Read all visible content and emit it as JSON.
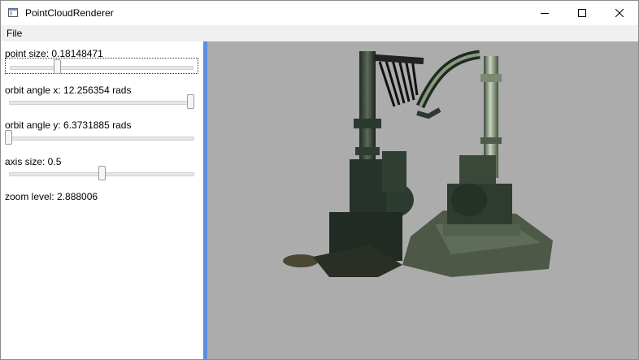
{
  "window": {
    "title": "PointCloudRenderer"
  },
  "menu": {
    "file": "File"
  },
  "controls": {
    "point_size": {
      "label": "point size: 0.18148471",
      "value_fraction": 0.26
    },
    "orbit_x": {
      "label": "orbit angle x: 12.256354 rads",
      "value_fraction": 0.98
    },
    "orbit_y": {
      "label": "orbit angle y: 6.3731885 rads",
      "value_fraction": 0.0
    },
    "axis_size": {
      "label": "axis size: 0.5",
      "value_fraction": 0.5
    },
    "zoom": {
      "label": "zoom level: 2.888006"
    }
  },
  "colors": {
    "viewport_bg": "#acacac",
    "splitter": "#5d8fe0",
    "menubar_bg": "#f0f0f0"
  }
}
